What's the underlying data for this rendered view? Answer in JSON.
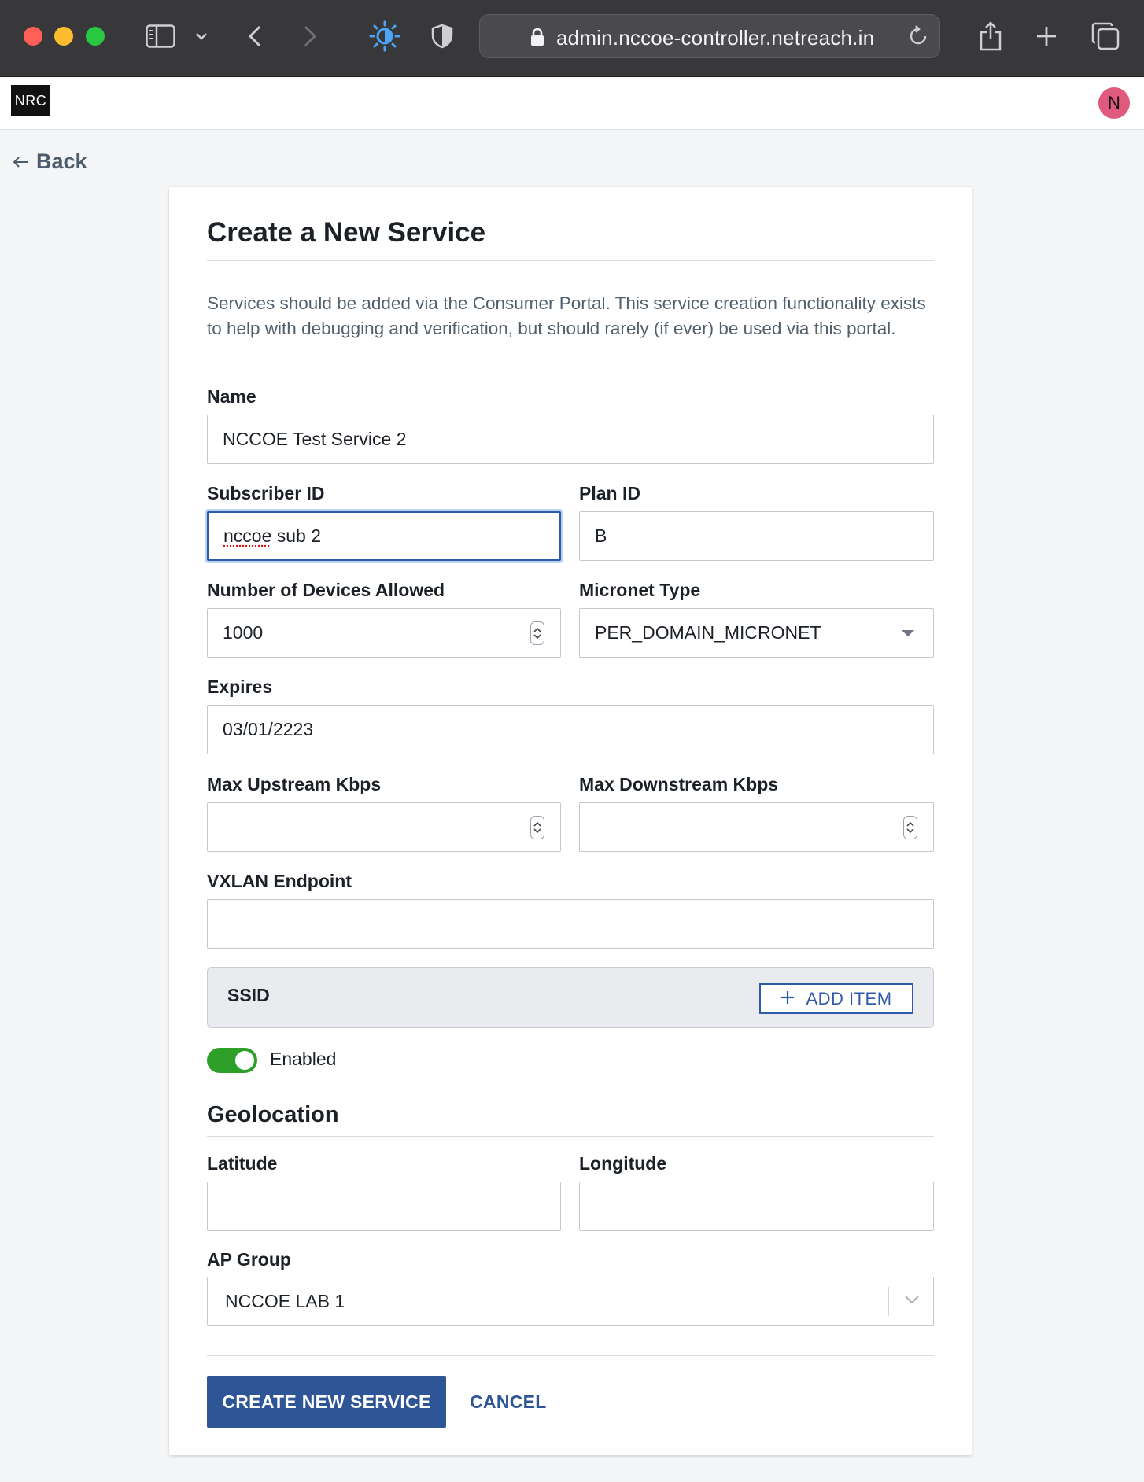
{
  "browser": {
    "url": "admin.nccoe-controller.netreach.in",
    "icons": [
      "sidebar-icon",
      "chevron-down-icon",
      "back-arrow-icon",
      "forward-arrow-icon",
      "brightness-icon",
      "shield-icon",
      "lock-icon",
      "reload-icon",
      "share-icon",
      "plus-icon",
      "tabs-icon"
    ]
  },
  "app": {
    "logo_text": "NRC",
    "avatar_initial": "N",
    "avatar_color": "#e05a7e"
  },
  "nav": {
    "back_label": "Back"
  },
  "form": {
    "title": "Create a New Service",
    "description": "Services should be added via the Consumer Portal. This service creation functionality exists to help with debugging and verification, but should rarely (if ever) be used via this portal.",
    "name": {
      "label": "Name",
      "value": "NCCOE Test Service 2"
    },
    "subscriber_id": {
      "label": "Subscriber ID",
      "value_word": "nccoe",
      "value_rest": " sub 2"
    },
    "plan_id": {
      "label": "Plan ID",
      "value": "B"
    },
    "devices_allowed": {
      "label": "Number of Devices Allowed",
      "value": "1000"
    },
    "micronet_type": {
      "label": "Micronet Type",
      "value": "PER_DOMAIN_MICRONET"
    },
    "expires": {
      "label": "Expires",
      "value": "03/01/2223"
    },
    "max_upstream": {
      "label": "Max Upstream Kbps",
      "value": ""
    },
    "max_downstream": {
      "label": "Max Downstream Kbps",
      "value": ""
    },
    "vxlan_endpoint": {
      "label": "VXLAN Endpoint",
      "value": ""
    },
    "ssid": {
      "label": "SSID",
      "add_label": "ADD ITEM"
    },
    "enabled": {
      "label": "Enabled",
      "on": true,
      "color": "#2ea02a"
    },
    "geolocation": {
      "title": "Geolocation",
      "latitude": {
        "label": "Latitude",
        "value": ""
      },
      "longitude": {
        "label": "Longitude",
        "value": ""
      }
    },
    "ap_group": {
      "label": "AP Group",
      "value": "NCCOE LAB 1"
    },
    "submit_label": "CREATE NEW SERVICE",
    "cancel_label": "CANCEL",
    "accent_color": "#2e5596"
  }
}
